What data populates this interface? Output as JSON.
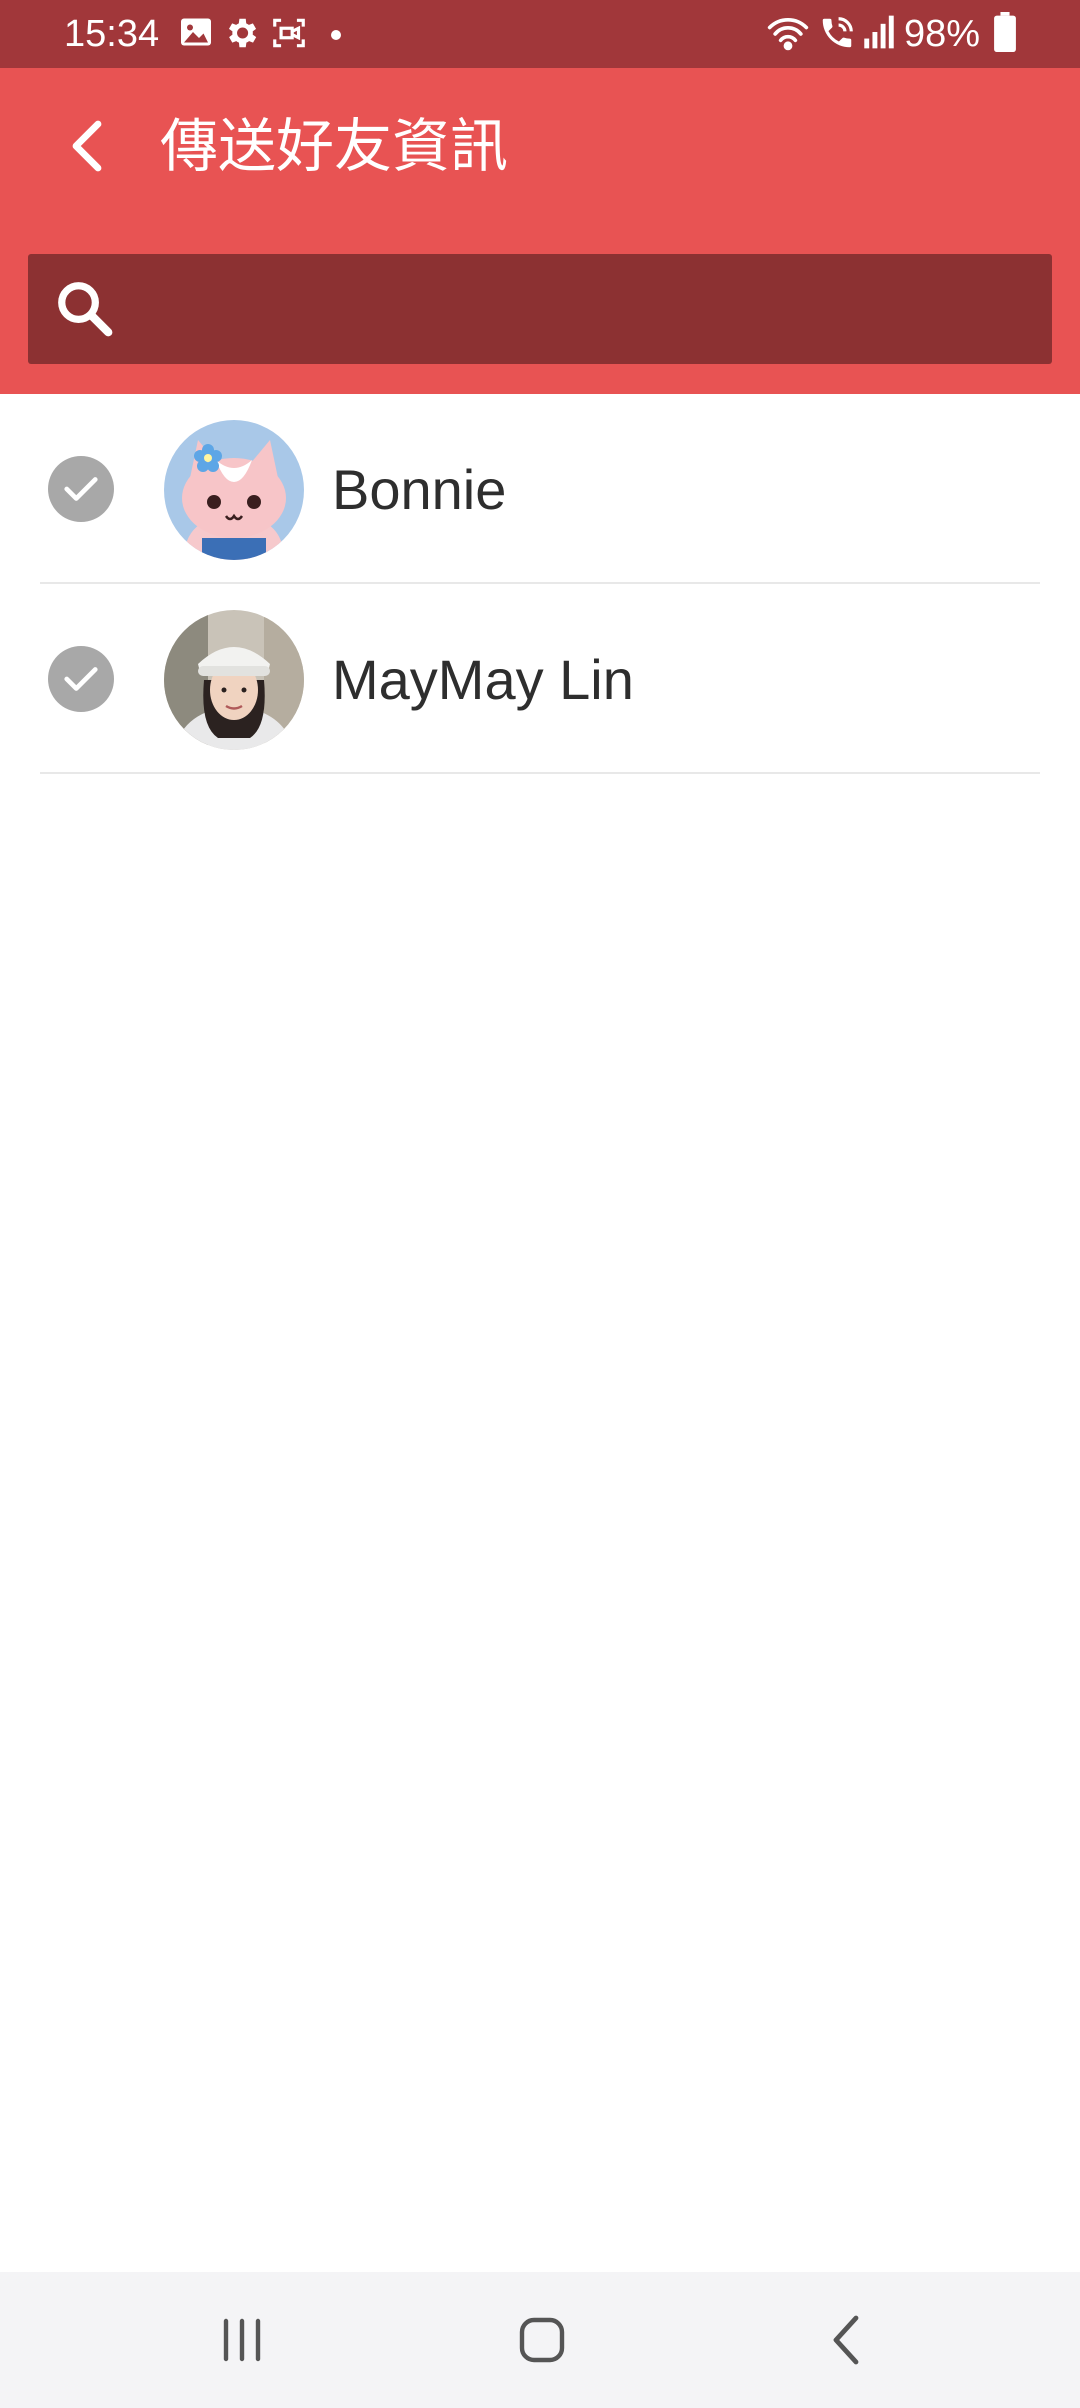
{
  "status_bar": {
    "time": "15:34",
    "battery": "98%",
    "icons": [
      "image-icon",
      "gear-icon",
      "screen-record-icon",
      "dot-icon",
      "wifi-icon",
      "wifi-call-icon",
      "signal-icon",
      "battery-icon"
    ]
  },
  "header": {
    "title": "傳送好友資訊",
    "back_icon": "chevron-left-icon"
  },
  "search": {
    "placeholder": "",
    "value": "",
    "icon": "search-icon"
  },
  "friends": [
    {
      "name": "Bonnie",
      "selected": true,
      "avatar": "pink-cat-sticker-avatar"
    },
    {
      "name": "MayMay Lin",
      "selected": true,
      "avatar": "photo-avatar"
    }
  ],
  "nav": {
    "recents_icon": "recents-icon",
    "home_icon": "home-icon",
    "back_icon": "back-icon"
  },
  "colors": {
    "status_bar": "#a1373a",
    "app_bar": "#e85353",
    "search_bg": "#8c3132",
    "check_bg": "#a8a8a8",
    "nav_bg": "#f4f4f6"
  }
}
